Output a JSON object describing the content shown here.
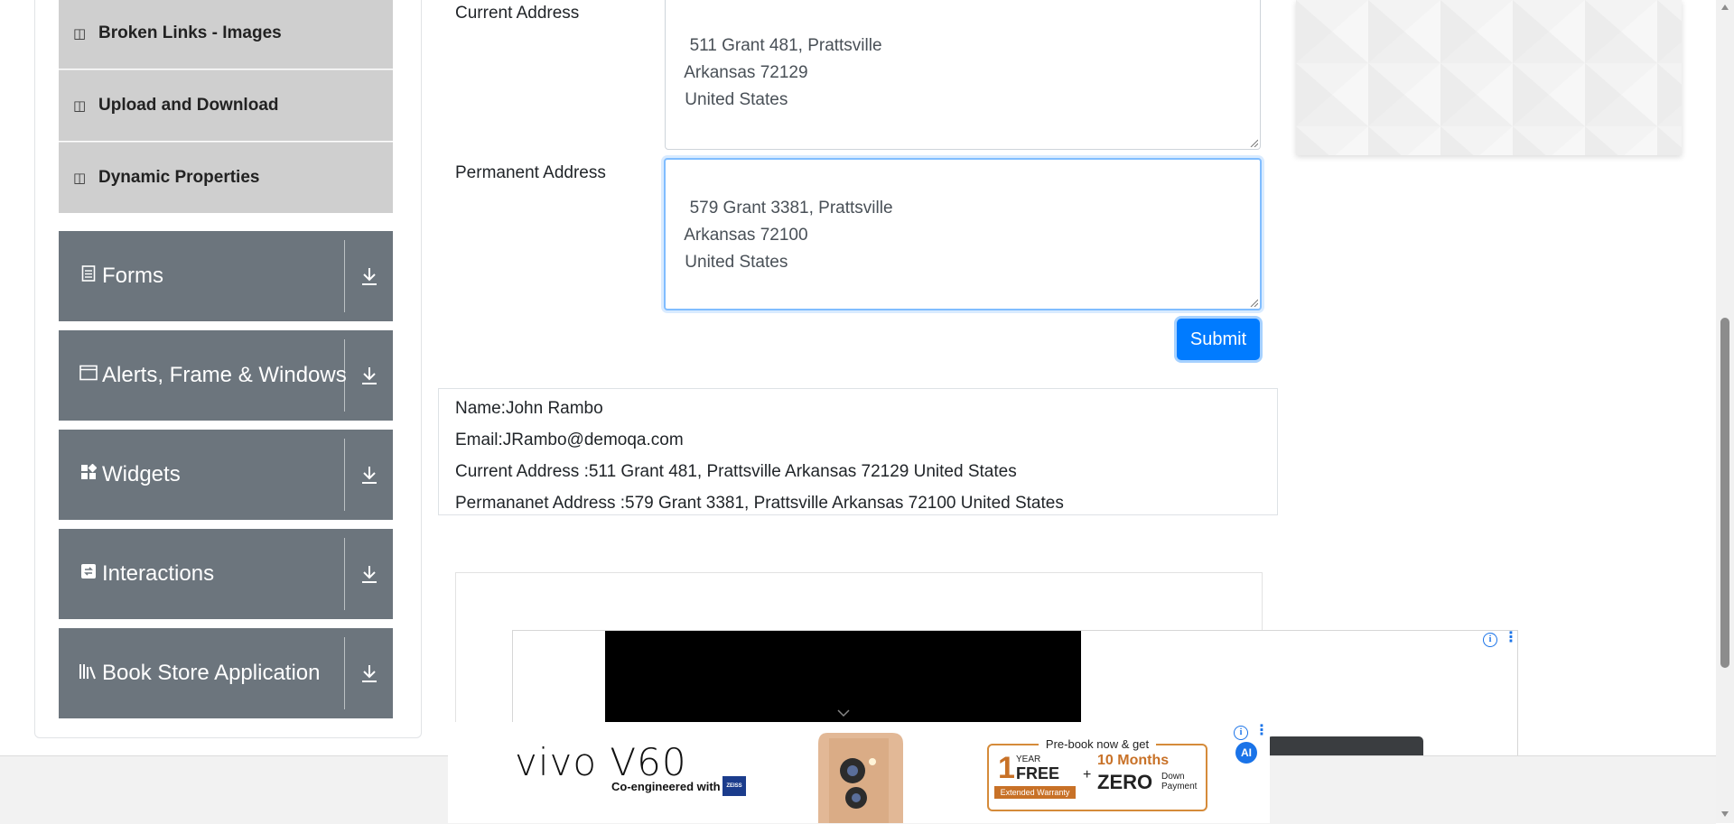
{
  "sidebar": {
    "sub_items": [
      {
        "label": "Broken Links - Images",
        "icon": "html5-icon"
      },
      {
        "label": "Upload and Download",
        "icon": "html5-icon"
      },
      {
        "label": "Dynamic Properties",
        "icon": "html5-icon"
      }
    ],
    "groups": [
      {
        "label": "Forms",
        "icon": "document-icon"
      },
      {
        "label": "Alerts, Frame & Windows",
        "icon": "window-icon"
      },
      {
        "label": "Widgets",
        "icon": "widgets-icon"
      },
      {
        "label": "Interactions",
        "icon": "interactions-icon"
      },
      {
        "label": "Book Store Application",
        "icon": "books-icon"
      }
    ]
  },
  "form": {
    "current_address_label": "Current Address",
    "current_address_value": "511 Grant 481, Prattsville\n Arkansas 72129\n United States",
    "permanent_address_label": "Permanent Address",
    "permanent_address_value": "579 Grant 3381, Prattsville\n Arkansas 72100\n United States",
    "submit_label": "Submit"
  },
  "output": {
    "name": "Name:John Rambo",
    "email": "Email:JRambo@demoqa.com",
    "current_address": "Current Address :511 Grant 481, Prattsville Arkansas 72129 United States",
    "permanent_address": "Permananet Address :579 Grant 3381, Prattsville Arkansas 72100 United States"
  },
  "ad": {
    "brand": "vivo V60",
    "tagline": "Co-engineered with",
    "partner": "ZEISS",
    "headline": "Pre-book now & get",
    "offer_year": "1",
    "offer_year_unit": "YEAR",
    "offer_free": "FREE",
    "offer_warranty": "Extended Warranty",
    "offer_plus": "+",
    "offer_months": "10 Months",
    "offer_zero": "ZERO",
    "offer_down": "Down",
    "offer_payment": "Payment",
    "ai_badge": "AI"
  },
  "colors": {
    "sidebar_group_bg": "#6c757d",
    "sidebar_sub_bg": "#cfcfcf",
    "submit_bg": "#007bff"
  }
}
